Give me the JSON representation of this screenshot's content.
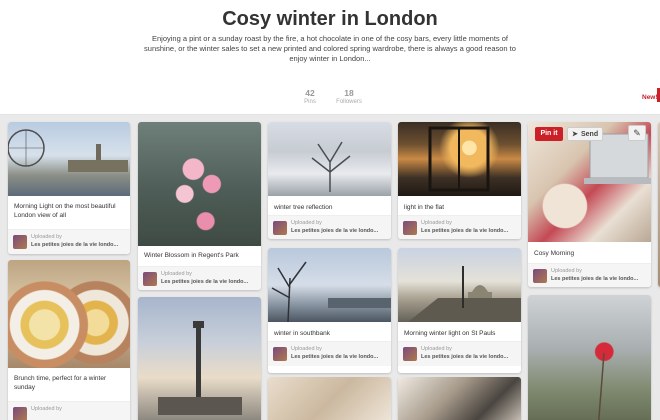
{
  "board": {
    "title": "Cosy winter in London",
    "description": "Enjoying a pint or a sunday roast by the fire, a hot chocolate in one of the cosy bars, every little moments of sunshine, or the winter sales to set a new printed and colored spring wardrobe, there is always a good reason to enjoy winter in London...",
    "stats": [
      {
        "value": "42",
        "label": "Pins"
      },
      {
        "value": "18",
        "label": "Followers"
      }
    ],
    "new_badge": "New!"
  },
  "pin_actions": {
    "pinit": "Pin it",
    "send": "Send",
    "edit_icon": "pencil-icon",
    "send_icon": "paper-plane-icon"
  },
  "uploaded_label": "Uploaded by",
  "board_name": "Les petites joies de la vie londo...",
  "pins": [
    {
      "caption": "Morning Light on the most beautiful London view of all"
    },
    {
      "caption": "Brunch time, perfect for a winter sunday"
    },
    {
      "caption": "Winter Blossom in Regent's Park"
    },
    {
      "caption": ""
    },
    {
      "caption": "winter tree reflection"
    },
    {
      "caption": "winter in southbank"
    },
    {
      "caption": ""
    },
    {
      "caption": "light in the flat"
    },
    {
      "caption": "Morning winter light on St Pauls"
    },
    {
      "caption": ""
    },
    {
      "caption": "Cosy Morning"
    },
    {
      "caption": ""
    }
  ]
}
